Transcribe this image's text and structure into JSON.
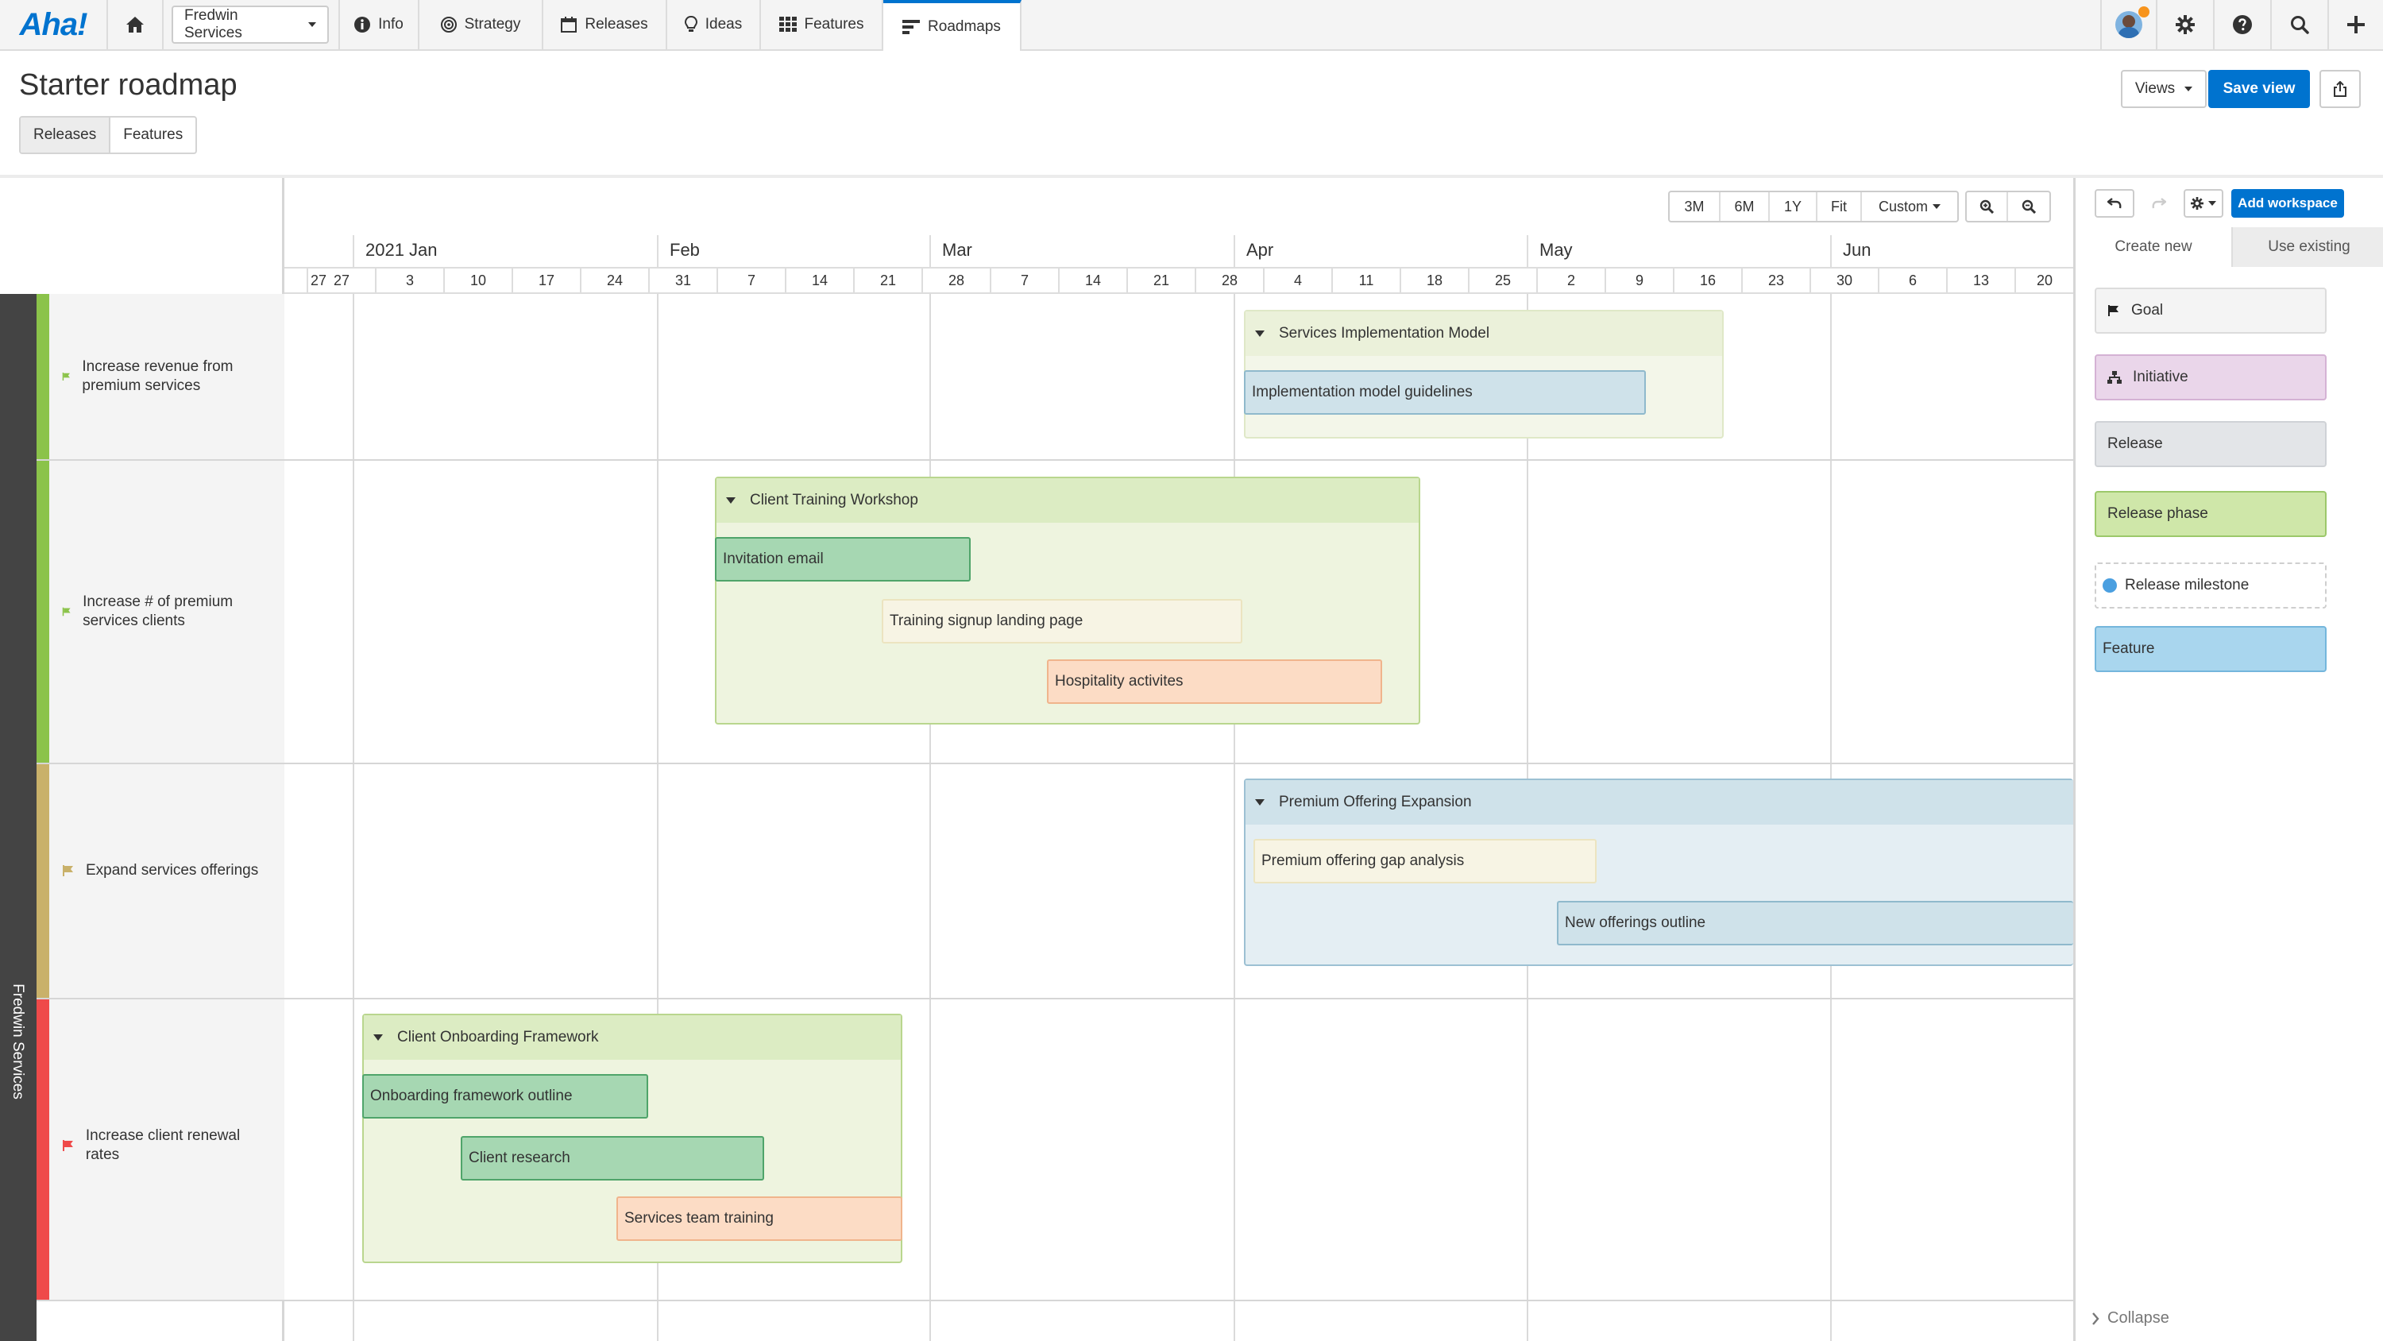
{
  "nav": {
    "logo": "Aha!",
    "workspace": "Fredwin Services",
    "items": [
      {
        "label": "Info"
      },
      {
        "label": "Strategy"
      },
      {
        "label": "Releases"
      },
      {
        "label": "Ideas"
      },
      {
        "label": "Features"
      },
      {
        "label": "Roadmaps",
        "active": true
      }
    ]
  },
  "page": {
    "title": "Starter roadmap",
    "tabs": [
      "Releases",
      "Features"
    ],
    "views_label": "Views",
    "save_view_label": "Save view"
  },
  "timeline": {
    "zoom_options": [
      "3M",
      "6M",
      "1Y",
      "Fit",
      "Custom"
    ],
    "months": [
      "2021 Jan",
      "Feb",
      "Mar",
      "Apr",
      "May",
      "Jun"
    ],
    "weeks": [
      "27",
      "3",
      "10",
      "17",
      "24",
      "31",
      "7",
      "14",
      "21",
      "28",
      "7",
      "14",
      "21",
      "28",
      "4",
      "11",
      "18",
      "25",
      "2",
      "9",
      "16",
      "23",
      "30",
      "6",
      "13",
      "20"
    ]
  },
  "workspace_strip": "Fredwin Services",
  "goals": [
    {
      "label": "Increase revenue from premium services",
      "color": "#8bc34a"
    },
    {
      "label": "Increase # of premium services clients",
      "color": "#8bc34a"
    },
    {
      "label": "Expand services offerings",
      "color": "#c9b16a"
    },
    {
      "label": "Increase client renewal rates",
      "color": "#ef4a4a"
    }
  ],
  "roadmap": {
    "releases": [
      {
        "name": "Services Implementation Model",
        "features": [
          "Implementation model guidelines"
        ]
      },
      {
        "name": "Client Training Workshop",
        "features": [
          "Invitation email",
          "Training signup landing page",
          "Hospitality activites"
        ]
      },
      {
        "name": "Premium Offering Expansion",
        "features": [
          "Premium offering gap analysis",
          "New offerings outline"
        ]
      },
      {
        "name": "Client Onboarding Framework",
        "features": [
          "Onboarding framework outline",
          "Client research",
          "Services team training"
        ]
      }
    ]
  },
  "panel": {
    "add_workspace": "Add workspace",
    "tabs": [
      "Create new",
      "Use existing"
    ],
    "cards": [
      {
        "label": "Goal",
        "icon": "flag-icon"
      },
      {
        "label": "Initiative",
        "icon": "hierarchy-icon"
      },
      {
        "label": "Release"
      },
      {
        "label": "Release phase"
      },
      {
        "label": "Release milestone",
        "icon": "circle-icon"
      },
      {
        "label": "Feature"
      }
    ],
    "collapse": "Collapse"
  }
}
